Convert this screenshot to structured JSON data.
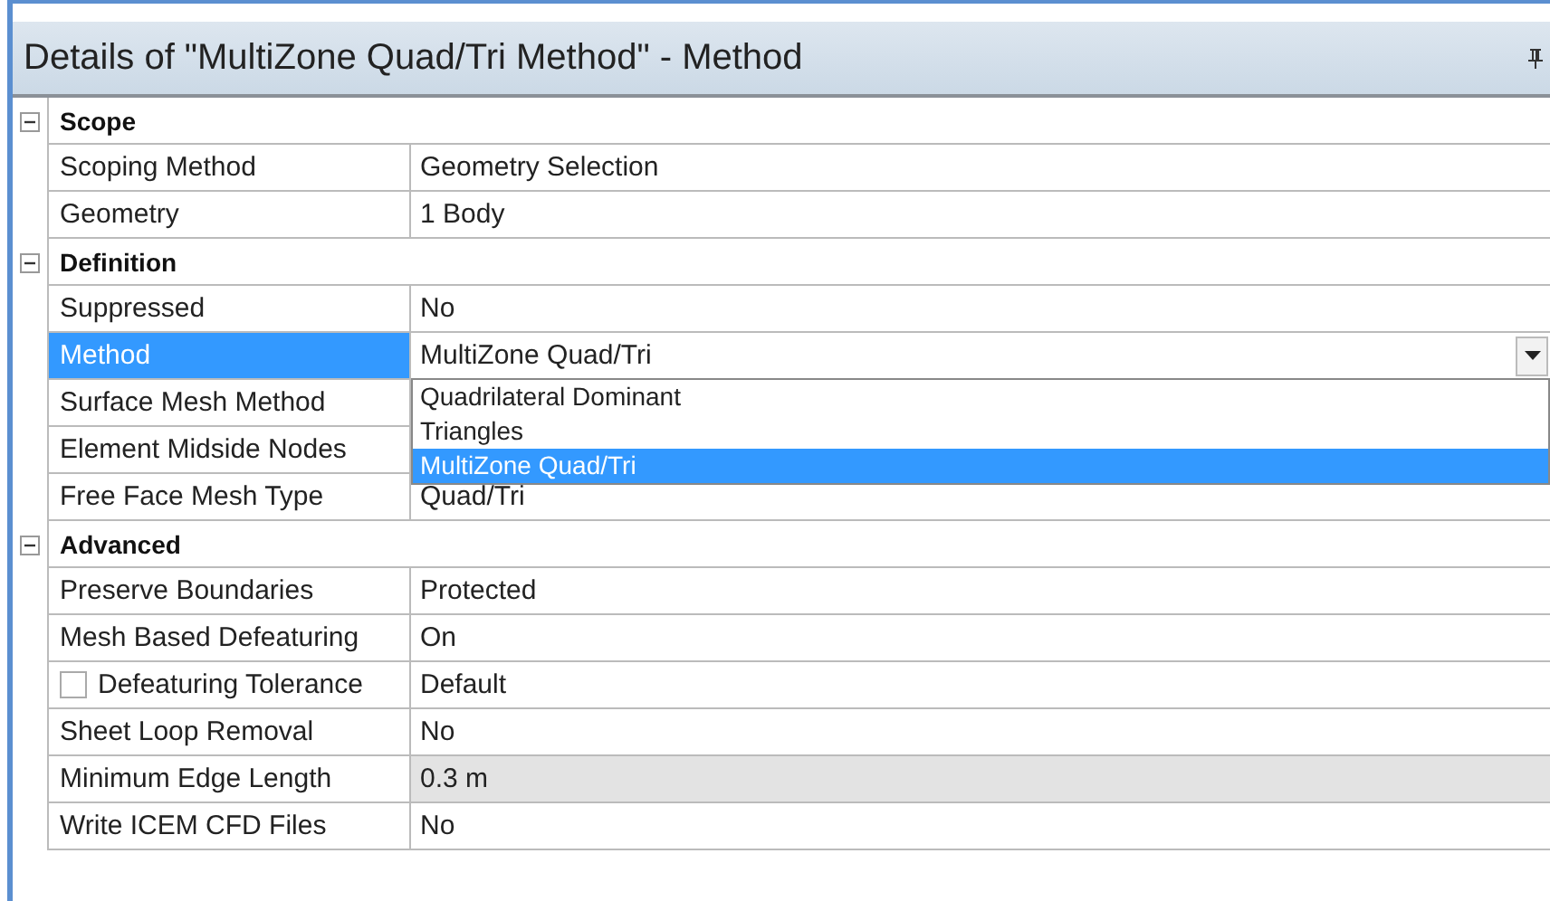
{
  "panel": {
    "title": "Details of \"MultiZone Quad/Tri Method\" - Method"
  },
  "sections": [
    {
      "title": "Scope",
      "expanded": true,
      "rows": [
        {
          "label": "Scoping Method",
          "value": "Geometry Selection",
          "selected": false,
          "greyed": false
        },
        {
          "label": "Geometry",
          "value": "1 Body",
          "selected": false,
          "greyed": false
        }
      ]
    },
    {
      "title": "Definition",
      "expanded": true,
      "rows": [
        {
          "label": "Suppressed",
          "value": "No",
          "selected": false,
          "greyed": false
        },
        {
          "label": "Method",
          "value": "MultiZone Quad/Tri",
          "selected": true,
          "greyed": false,
          "kind": "combo",
          "open": true,
          "options": [
            {
              "label": "Quadrilateral Dominant",
              "selected": false
            },
            {
              "label": "Triangles",
              "selected": false
            },
            {
              "label": "MultiZone Quad/Tri",
              "selected": true
            }
          ]
        },
        {
          "label": "Surface Mesh Method",
          "selected": false
        },
        {
          "label": "Element Midside Nodes",
          "selected": false
        },
        {
          "label": "Free Face Mesh Type",
          "value": "Quad/Tri",
          "selected": false,
          "greyed": false
        }
      ]
    },
    {
      "title": "Advanced",
      "expanded": true,
      "rows": [
        {
          "label": "Preserve Boundaries",
          "value": "Protected",
          "selected": false,
          "greyed": false
        },
        {
          "label": "Mesh Based Defeaturing",
          "value": "On",
          "selected": false,
          "greyed": false
        },
        {
          "label": "Defeaturing Tolerance",
          "value": "Default",
          "selected": false,
          "greyed": false,
          "kind": "check",
          "checked": false
        },
        {
          "label": "Sheet Loop Removal",
          "value": "No",
          "selected": false,
          "greyed": false
        },
        {
          "label": "Minimum Edge Length",
          "value": "0.3 m",
          "selected": false,
          "greyed": true
        },
        {
          "label": "Write ICEM CFD Files",
          "value": "No",
          "selected": false,
          "greyed": false
        }
      ]
    }
  ]
}
